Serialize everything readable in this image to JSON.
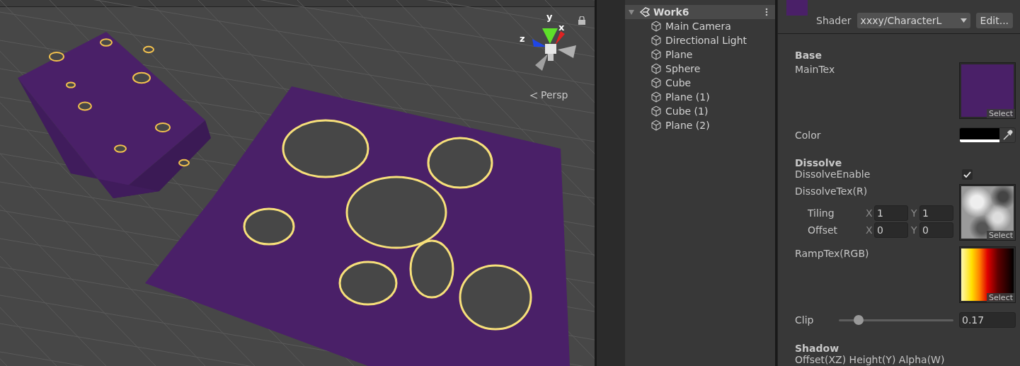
{
  "scene": {
    "gizmo": {
      "axes": [
        {
          "label": "y",
          "color": "#5ee02a"
        },
        {
          "label": "x",
          "color": "#e02222"
        },
        {
          "label": "z",
          "color": "#2046e6"
        }
      ],
      "projection": "Persp"
    }
  },
  "hierarchy": {
    "scene": {
      "name": "Work6",
      "expanded": true,
      "children": [
        {
          "name": "Main Camera"
        },
        {
          "name": "Directional Light"
        },
        {
          "name": "Plane"
        },
        {
          "name": "Sphere"
        },
        {
          "name": "Cube"
        },
        {
          "name": "Plane (1)"
        },
        {
          "name": "Cube (1)"
        },
        {
          "name": "Plane (2)"
        }
      ]
    }
  },
  "inspector": {
    "shader_label": "Shader",
    "shader": "xxxy/CharacterL",
    "edit_button": "Edit...",
    "sections": [
      {
        "title": "Base",
        "properties": [
          {
            "kind": "texture",
            "label": "MainTex",
            "texture": {
              "kind": "solid",
              "color": "#4a2068"
            },
            "select": "Select"
          },
          {
            "kind": "color",
            "label": "Color",
            "color": "#000000"
          }
        ]
      },
      {
        "title": "Dissolve",
        "properties": [
          {
            "kind": "toggle",
            "label": "DissolveEnable",
            "checked": true
          },
          {
            "kind": "texture",
            "label": "DissolveTex(R)",
            "texture": {
              "kind": "noise"
            },
            "select": "Select",
            "transform": [
              {
                "label": "Tiling",
                "fields": [
                  {
                    "axis": "X",
                    "value": "1"
                  },
                  {
                    "axis": "Y",
                    "value": "1"
                  }
                ]
              },
              {
                "label": "Offset",
                "fields": [
                  {
                    "axis": "X",
                    "value": "0"
                  },
                  {
                    "axis": "Y",
                    "value": "0"
                  }
                ]
              }
            ]
          },
          {
            "kind": "texture",
            "label": "RampTex(RGB)",
            "texture": {
              "kind": "ramp"
            },
            "select": "Select"
          },
          {
            "kind": "slider",
            "label": "Clip",
            "level": 0.17,
            "value": "0.17"
          }
        ]
      },
      {
        "title": "Shadow",
        "properties": [
          {
            "kind": "label",
            "label": "Offset(XZ) Height(Y) Alpha(W)"
          }
        ]
      }
    ]
  }
}
